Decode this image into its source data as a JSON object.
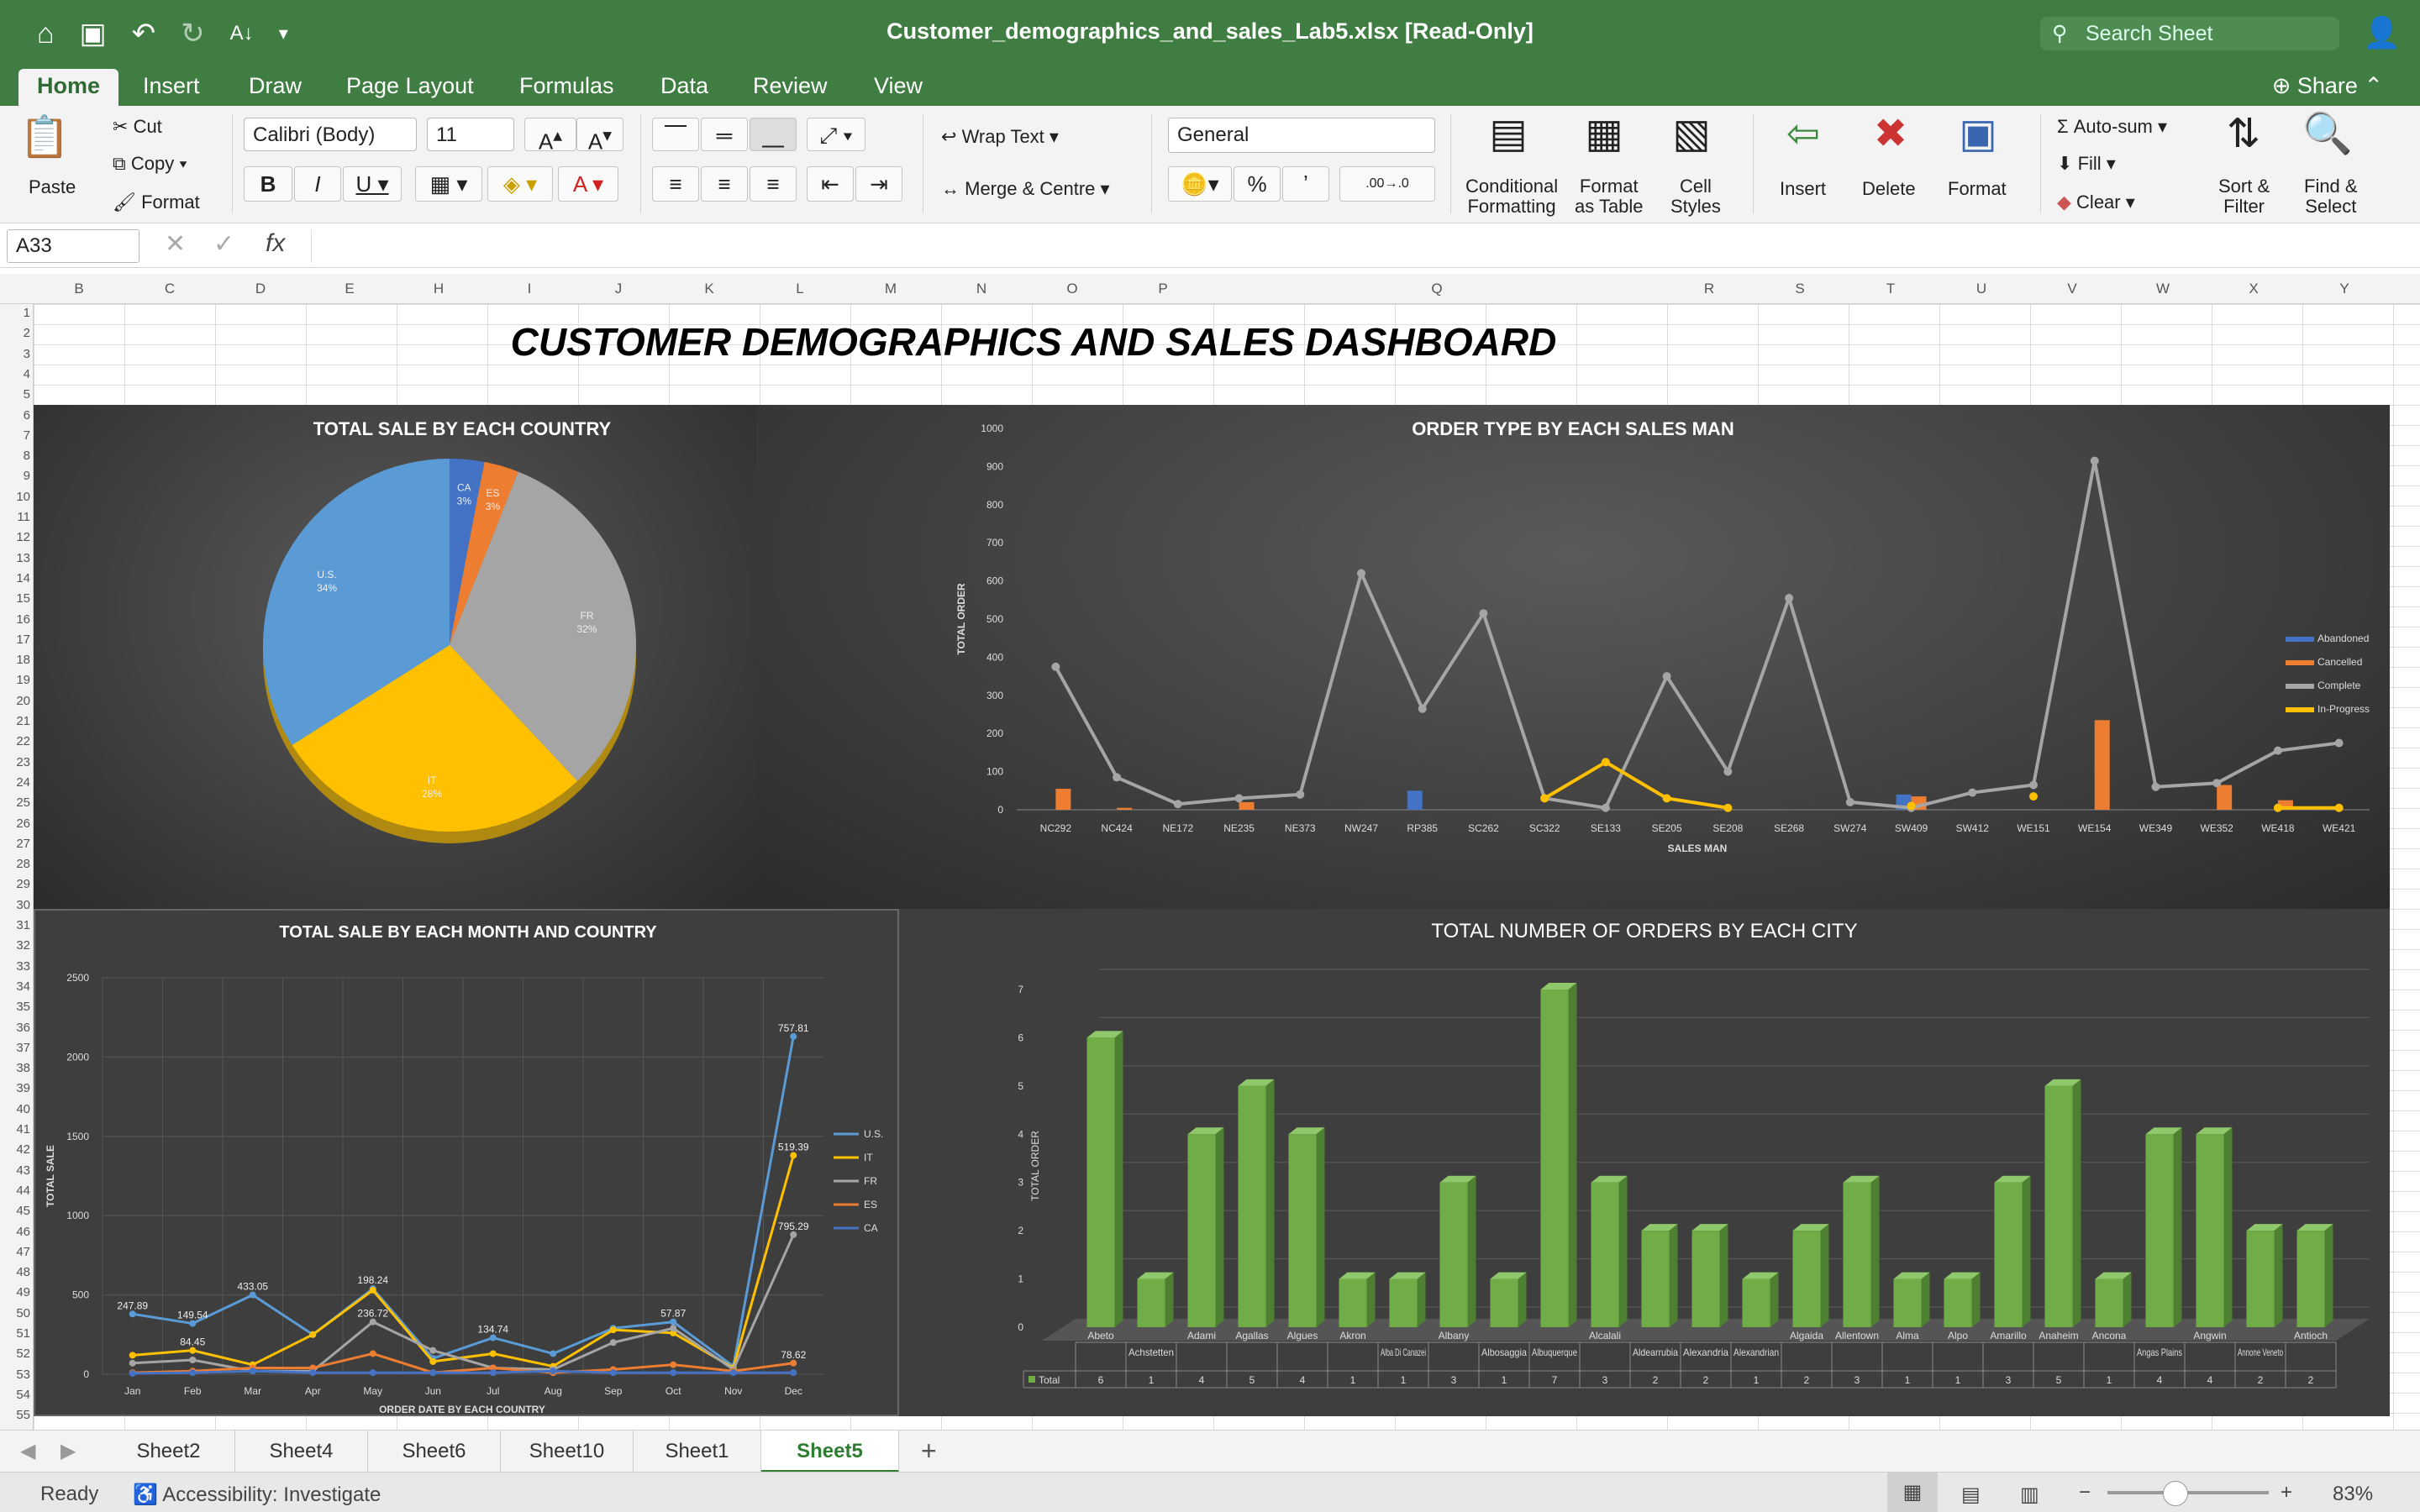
{
  "window": {
    "title": "Customer_demographics_and_sales_Lab5.xlsx  [Read-Only]",
    "search_placeholder": "Search Sheet",
    "share": "Share"
  },
  "ribbon_tabs": [
    "Home",
    "Insert",
    "Draw",
    "Page Layout",
    "Formulas",
    "Data",
    "Review",
    "View"
  ],
  "ribbon": {
    "paste": "Paste",
    "cut": "Cut",
    "copy": "Copy",
    "format": "Format",
    "font": "Calibri (Body)",
    "size": "11",
    "wrap": "Wrap Text",
    "merge": "Merge & Centre",
    "numfmt": "General",
    "percent": "%",
    "comma": "ʼ",
    "inc_dec": ".00→.0",
    "cond_fmt_1": "Conditional",
    "cond_fmt_2": "Formatting",
    "as_table_1": "Format",
    "as_table_2": "as Table",
    "cell_styles_1": "Cell",
    "cell_styles_2": "Styles",
    "insert": "Insert",
    "delete": "Delete",
    "format_cells": "Format",
    "autosum": "Auto-sum",
    "fill": "Fill",
    "clear": "Clear",
    "sort_1": "Sort &",
    "sort_2": "Filter",
    "find_1": "Find &",
    "find_2": "Select"
  },
  "formula_bar": {
    "cell": "A33",
    "fx": "fx",
    "value": ""
  },
  "columns": [
    "B",
    "C",
    "D",
    "E",
    "H",
    "I",
    "J",
    "K",
    "L",
    "M",
    "N",
    "O",
    "P",
    "Q",
    "R",
    "S",
    "T",
    "U",
    "V",
    "W",
    "X",
    "Y"
  ],
  "rows": [
    "1",
    "2",
    "3",
    "4",
    "5",
    "6",
    "7",
    "8",
    "9",
    "10",
    "11",
    "12",
    "13",
    "14",
    "15",
    "16",
    "17",
    "18",
    "19",
    "20",
    "21",
    "22",
    "23",
    "24",
    "25",
    "26",
    "27",
    "28",
    "29",
    "30",
    "31",
    "32",
    "33",
    "34",
    "35",
    "36",
    "37",
    "38",
    "39",
    "40",
    "41",
    "42",
    "43",
    "44",
    "45",
    "46",
    "47",
    "48",
    "49",
    "50",
    "51",
    "52",
    "53",
    "54",
    "55"
  ],
  "dashboard_title": "CUSTOMER DEMOGRAPHICS AND SALES DASHBOARD",
  "chart_data": [
    {
      "type": "pie",
      "title": "TOTAL SALE BY EACH COUNTRY",
      "slices": [
        {
          "label": "CA",
          "value": 3,
          "pct": "3%",
          "color": "#4472c4"
        },
        {
          "label": "ES",
          "value": 3,
          "pct": "3%",
          "color": "#ed7d31"
        },
        {
          "label": "FR",
          "value": 32,
          "pct": "32%",
          "color": "#a5a5a5"
        },
        {
          "label": "IT",
          "value": 28,
          "pct": "28%",
          "color": "#ffc000"
        },
        {
          "label": "U.S.",
          "value": 34,
          "pct": "34%",
          "color": "#5b9bd5"
        }
      ]
    },
    {
      "type": "line",
      "title": "ORDER TYPE BY EACH SALES MAN",
      "xlabel": "SALES MAN",
      "ylabel": "TOTAL ORDER",
      "ylim": [
        0,
        1000
      ],
      "yticks": [
        0,
        100,
        200,
        300,
        400,
        500,
        600,
        700,
        800,
        900,
        1000
      ],
      "categories": [
        "NC292",
        "NC424",
        "NE172",
        "NE235",
        "NE373",
        "NW247",
        "RP385",
        "SC262",
        "SC322",
        "SE133",
        "SE205",
        "SE208",
        "SE268",
        "SW274",
        "SW409",
        "SW412",
        "WE151",
        "WE154",
        "WE349",
        "WE352",
        "WE418",
        "WE421"
      ],
      "series": [
        {
          "name": "Abandoned",
          "kind": "bar",
          "color": "#4472c4",
          "values": [
            0,
            0,
            0,
            0,
            0,
            0,
            50,
            0,
            0,
            0,
            0,
            0,
            0,
            0,
            40,
            0,
            0,
            0,
            0,
            0,
            0,
            0
          ]
        },
        {
          "name": "Cancelled",
          "kind": "bar",
          "color": "#ed7d31",
          "values": [
            55,
            5,
            0,
            20,
            0,
            0,
            0,
            0,
            0,
            0,
            0,
            0,
            0,
            0,
            35,
            0,
            0,
            235,
            0,
            65,
            25,
            0
          ]
        },
        {
          "name": "Complete",
          "kind": "line",
          "color": "#a5a5a5",
          "values": [
            375,
            85,
            15,
            30,
            40,
            620,
            265,
            515,
            30,
            5,
            350,
            100,
            555,
            20,
            5,
            45,
            65,
            915,
            60,
            70,
            155,
            175
          ]
        },
        {
          "name": "In-Progress",
          "kind": "line",
          "color": "#ffc000",
          "values": [
            null,
            null,
            null,
            null,
            null,
            null,
            null,
            null,
            30,
            125,
            30,
            5,
            null,
            null,
            10,
            null,
            35,
            null,
            null,
            null,
            5,
            5
          ]
        }
      ]
    },
    {
      "type": "line",
      "title": "TOTAL SALE BY EACH MONTH AND COUNTRY",
      "xlabel": "ORDER DATE BY EACH COUNTRY",
      "ylabel": "TOTAL SALE",
      "ylim": [
        0,
        2500
      ],
      "yticks": [
        0,
        500,
        1000,
        1500,
        2000,
        2500
      ],
      "categories": [
        "Jan",
        "Feb",
        "Mar",
        "Apr",
        "May",
        "Jun",
        "Jul",
        "Aug",
        "Sep",
        "Oct",
        "Nov",
        "Dec"
      ],
      "series": [
        {
          "name": "U.S.",
          "color": "#5b9bd5",
          "values": [
            380,
            320,
            500,
            250,
            540,
            100,
            230,
            130,
            290,
            330,
            50,
            2130
          ],
          "labels": [
            "247.89",
            "149.54",
            "433.05",
            "",
            "198.24",
            "",
            "134.74",
            "",
            "",
            "57.87",
            "",
            "757.81"
          ]
        },
        {
          "name": "IT",
          "color": "#ffc000",
          "values": [
            120,
            150,
            60,
            250,
            530,
            80,
            130,
            50,
            280,
            260,
            40,
            1380
          ],
          "labels": [
            "",
            "84.45",
            "",
            "",
            "",
            "",
            "",
            "",
            "",
            "",
            "",
            "519.39"
          ]
        },
        {
          "name": "FR",
          "color": "#a5a5a5",
          "values": [
            70,
            90,
            20,
            20,
            330,
            150,
            40,
            30,
            200,
            290,
            30,
            880
          ],
          "labels": [
            "",
            "",
            "",
            "",
            "236.72",
            "",
            "",
            "",
            "",
            "",
            "",
            "795.29"
          ]
        },
        {
          "name": "ES",
          "color": "#ed7d31",
          "values": [
            10,
            20,
            40,
            40,
            130,
            10,
            40,
            10,
            30,
            60,
            20,
            70
          ],
          "labels": [
            "",
            "",
            "",
            "",
            "",
            "",
            "",
            "",
            "",
            "",
            "",
            "78.62"
          ]
        },
        {
          "name": "CA",
          "color": "#4472c4",
          "values": [
            5,
            10,
            20,
            10,
            10,
            10,
            10,
            20,
            10,
            10,
            10,
            10
          ],
          "labels": [
            "",
            "",
            "",
            "",
            "",
            "",
            "",
            "",
            "",
            "",
            "",
            ""
          ]
        }
      ]
    },
    {
      "type": "bar",
      "title": "TOTAL NUMBER OF ORDERS BY EACH CITY",
      "ylabel": "TOTAL ORDER",
      "ylim": [
        0,
        7
      ],
      "yticks": [
        0,
        1,
        2,
        3,
        4,
        5,
        6,
        7
      ],
      "table_row_label": "Total",
      "color": "#70ad47",
      "categories": [
        "Abeto",
        "Achstetten",
        "Adami",
        "Agallas",
        "Algues",
        "Akron",
        "Alba Di Canazei",
        "Albany",
        "Albosaggia",
        "Albuquerque",
        "Alcalali",
        "Aldearrubia",
        "Alexandria",
        "Alexandrian",
        "Algaida",
        "Allentown",
        "Alma",
        "Alpo",
        "Amarillo",
        "Anaheim",
        "Ancona",
        "Angas Plains",
        "Angwin",
        "Annone Veneto",
        "Antioch"
      ],
      "values": [
        6,
        1,
        4,
        5,
        4,
        1,
        1,
        3,
        1,
        7,
        3,
        2,
        2,
        1,
        2,
        3,
        1,
        1,
        3,
        5,
        1,
        4,
        4,
        2,
        2
      ]
    }
  ],
  "sheets": [
    "Sheet2",
    "Sheet4",
    "Sheet6",
    "Sheet10",
    "Sheet1",
    "Sheet5"
  ],
  "active_sheet": "Sheet5",
  "status": {
    "ready": "Ready",
    "accessibility": "Accessibility: Investigate",
    "zoom": "83%"
  }
}
